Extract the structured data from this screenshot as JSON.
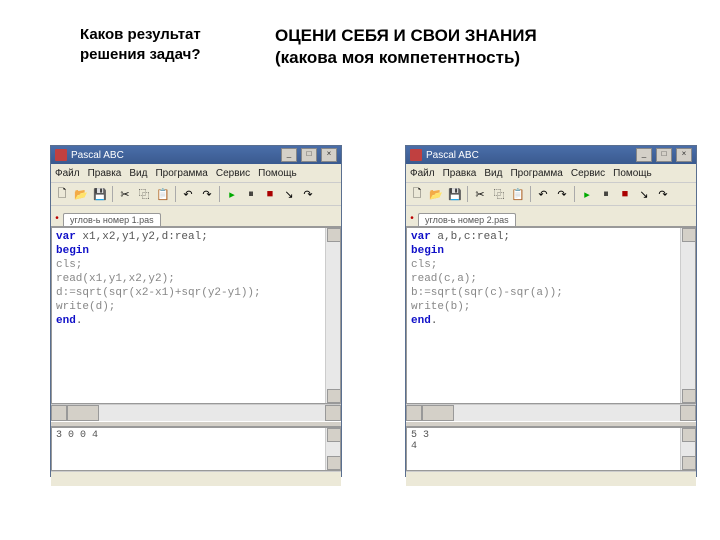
{
  "headings": {
    "left": "Каков результат решения задач?",
    "right_line1": "ОЦЕНИ СЕБЯ И СВОИ ЗНАНИЯ",
    "right_line2": "(какова моя компетентность)"
  },
  "app_title": "Pascal ABC",
  "menu": {
    "file": "Файл",
    "edit": "Правка",
    "view": "Вид",
    "program": "Программа",
    "service": "Сервис",
    "help": "Помощь"
  },
  "toolbar_icons": {
    "new": "🗋",
    "open": "📂",
    "save": "💾",
    "cut": "✂",
    "copy": "⿻",
    "paste": "📋",
    "undo": "↶",
    "redo": "↷",
    "run": "▸",
    "pause": "⏸",
    "stop": "■",
    "step": "↘",
    "stepover": "↷"
  },
  "left_window": {
    "tab": "углов-ь номер 1.pas",
    "code": {
      "var_kw": "var",
      "var_decl": " x1,x2,y1,y2,d:real;",
      "begin_kw": "begin",
      "line1": "cls;",
      "line2": "read(x1,y1,x2,y2);",
      "line3": "d:=sqrt(sqr(x2-x1)+sqr(y2-y1));",
      "line4": "write(d);",
      "end_kw": "end",
      "dot": "."
    },
    "output": "3 0 0 4"
  },
  "right_window": {
    "tab": "углов-ь номер 2.pas",
    "code": {
      "var_kw": "var",
      "var_decl": " a,b,c:real;",
      "begin_kw": "begin",
      "line1": "cls;",
      "line2": "read(c,a);",
      "line3": "b:=sqrt(sqr(c)-sqr(a));",
      "line4": "write(b);",
      "end_kw": "end",
      "dot": "."
    },
    "output_line1": "5  3",
    "output_line2": "4"
  }
}
